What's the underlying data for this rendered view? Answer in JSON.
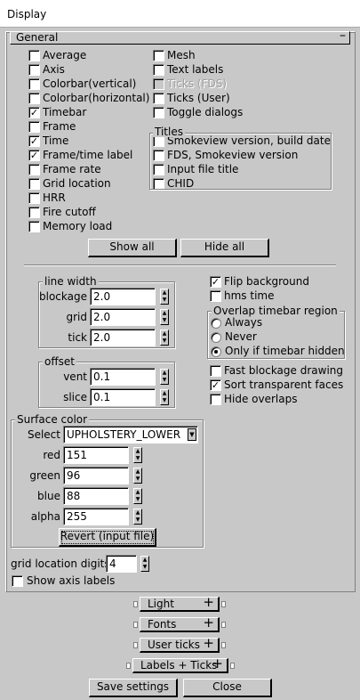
{
  "window": {
    "title": "Display"
  },
  "general": {
    "label": "General",
    "collapse": "–"
  },
  "left_checks": [
    {
      "label": "Average",
      "checked": false
    },
    {
      "label": "Axis",
      "checked": false
    },
    {
      "label": "Colorbar(vertical)",
      "checked": false
    },
    {
      "label": "Colorbar(horizontal)",
      "checked": false
    },
    {
      "label": "Timebar",
      "checked": true
    },
    {
      "label": "Frame",
      "checked": false
    },
    {
      "label": "Time",
      "checked": true
    },
    {
      "label": "Frame/time label",
      "checked": true
    },
    {
      "label": "Frame rate",
      "checked": false
    },
    {
      "label": "Grid location",
      "checked": false
    },
    {
      "label": "HRR",
      "checked": false
    },
    {
      "label": "Fire cutoff",
      "checked": false
    },
    {
      "label": "Memory load",
      "checked": false
    }
  ],
  "right_checks": [
    {
      "label": "Mesh",
      "checked": false
    },
    {
      "label": "Text labels",
      "checked": false
    },
    {
      "label": "Ticks (FDS)",
      "checked": false,
      "disabled": true
    },
    {
      "label": "Ticks (User)",
      "checked": false
    },
    {
      "label": "Toggle dialogs",
      "checked": false
    }
  ],
  "titles": {
    "label": "Titles",
    "items": [
      {
        "label": "Smokeview version, build date",
        "checked": false
      },
      {
        "label": "FDS, Smokeview version",
        "checked": false
      },
      {
        "label": "Input file title",
        "checked": false
      },
      {
        "label": "CHID",
        "checked": false
      }
    ]
  },
  "buttons": {
    "show_all": "Show all",
    "hide_all": "Hide all",
    "revert": "Revert (input file)",
    "save": "Save settings",
    "close": "Close"
  },
  "line_width": {
    "label": "line width",
    "rows": [
      {
        "label": "blockage",
        "value": "2.0"
      },
      {
        "label": "grid",
        "value": "2.0"
      },
      {
        "label": "tick",
        "value": "2.0"
      }
    ]
  },
  "offset": {
    "label": "offset",
    "rows": [
      {
        "label": "vent",
        "value": "0.1"
      },
      {
        "label": "slice",
        "value": "0.1"
      }
    ]
  },
  "right_opts": [
    {
      "label": "Flip background",
      "checked": true
    },
    {
      "label": "hms time",
      "checked": false
    }
  ],
  "overlap": {
    "label": "Overlap timebar region",
    "options": [
      {
        "label": "Always",
        "selected": false
      },
      {
        "label": "Never",
        "selected": false
      },
      {
        "label": "Only if timebar hidden",
        "selected": true
      }
    ]
  },
  "right_opts2": [
    {
      "label": "Fast blockage drawing",
      "checked": false
    },
    {
      "label": "Sort transparent faces",
      "checked": true
    },
    {
      "label": "Hide overlaps",
      "checked": false
    }
  ],
  "surface": {
    "label": "Surface color",
    "select_label": "Select",
    "selected": "UPHOLSTERY_LOWER",
    "rows": [
      {
        "label": "red",
        "value": "151"
      },
      {
        "label": "green",
        "value": "96"
      },
      {
        "label": "blue",
        "value": "88"
      },
      {
        "label": "alpha",
        "value": "255"
      }
    ]
  },
  "grid_digits": {
    "label": "grid location digits:",
    "value": "4"
  },
  "show_axis": {
    "label": "Show axis labels",
    "checked": false
  },
  "rollouts": [
    {
      "label": "Light"
    },
    {
      "label": "Fonts"
    },
    {
      "label": "User ticks"
    },
    {
      "label": "Labels + Ticks"
    }
  ],
  "rollout_expand": "+",
  "spinner_glyph": "▲▼"
}
